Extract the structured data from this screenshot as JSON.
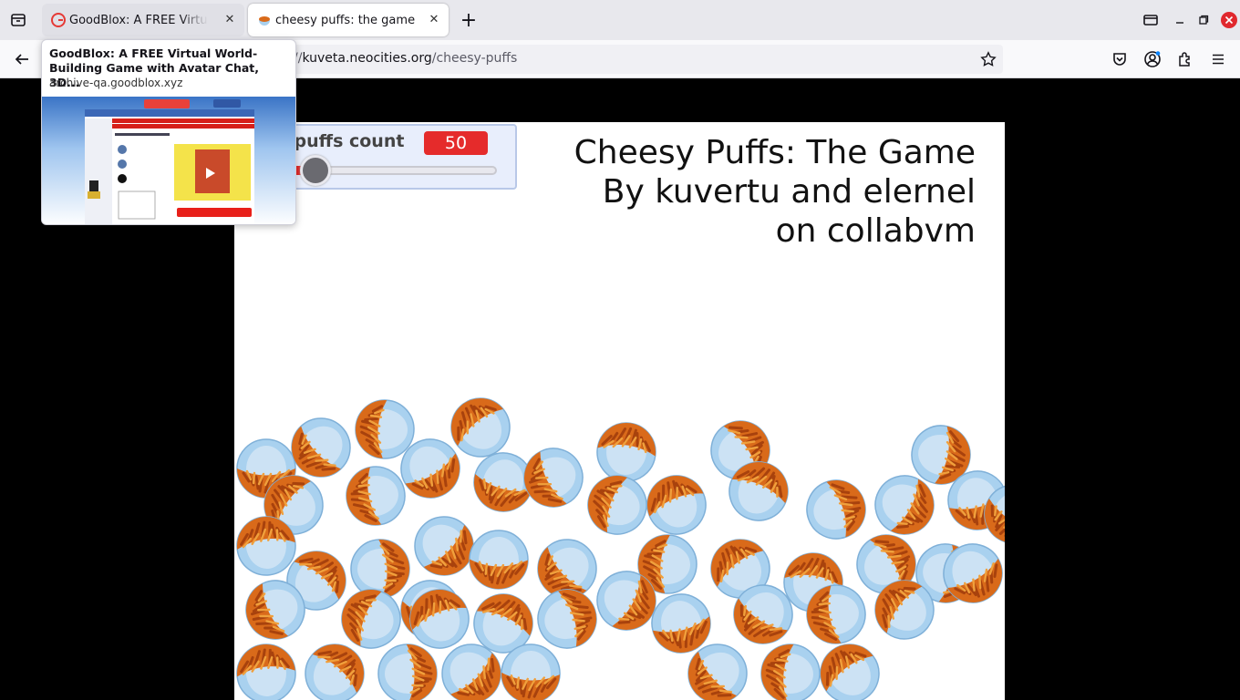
{
  "browser": {
    "tabs": [
      {
        "label": "GoodBlox: A FREE Virtual World-Building Game with Avatar Chat, 3D...",
        "active": false
      },
      {
        "label": "cheesy puffs: the game",
        "active": true
      }
    ],
    "url": {
      "prefix": "//",
      "host": "kuveta.neocities.org",
      "path": "/cheesy-puffs"
    },
    "close_tab_glyph": "✕",
    "new_tab_glyph": "+"
  },
  "preview": {
    "title": "GoodBlox: A FREE Virtual World-Building Game with Avatar Chat, 3D...",
    "domain": "archive-qa.goodblox.xyz"
  },
  "game": {
    "counter_label": "Cheesy puffs count",
    "counter_value": "50",
    "slider_fraction": 0.35,
    "title_lines": [
      "Cheesy Puffs: The Game",
      "By kuvertu and elernel",
      "on collabvm"
    ],
    "puff_count": 50
  },
  "colors": {
    "accent": "#e52b2b",
    "bowl": "#a9d1ef",
    "puff": "#d96a1a"
  }
}
